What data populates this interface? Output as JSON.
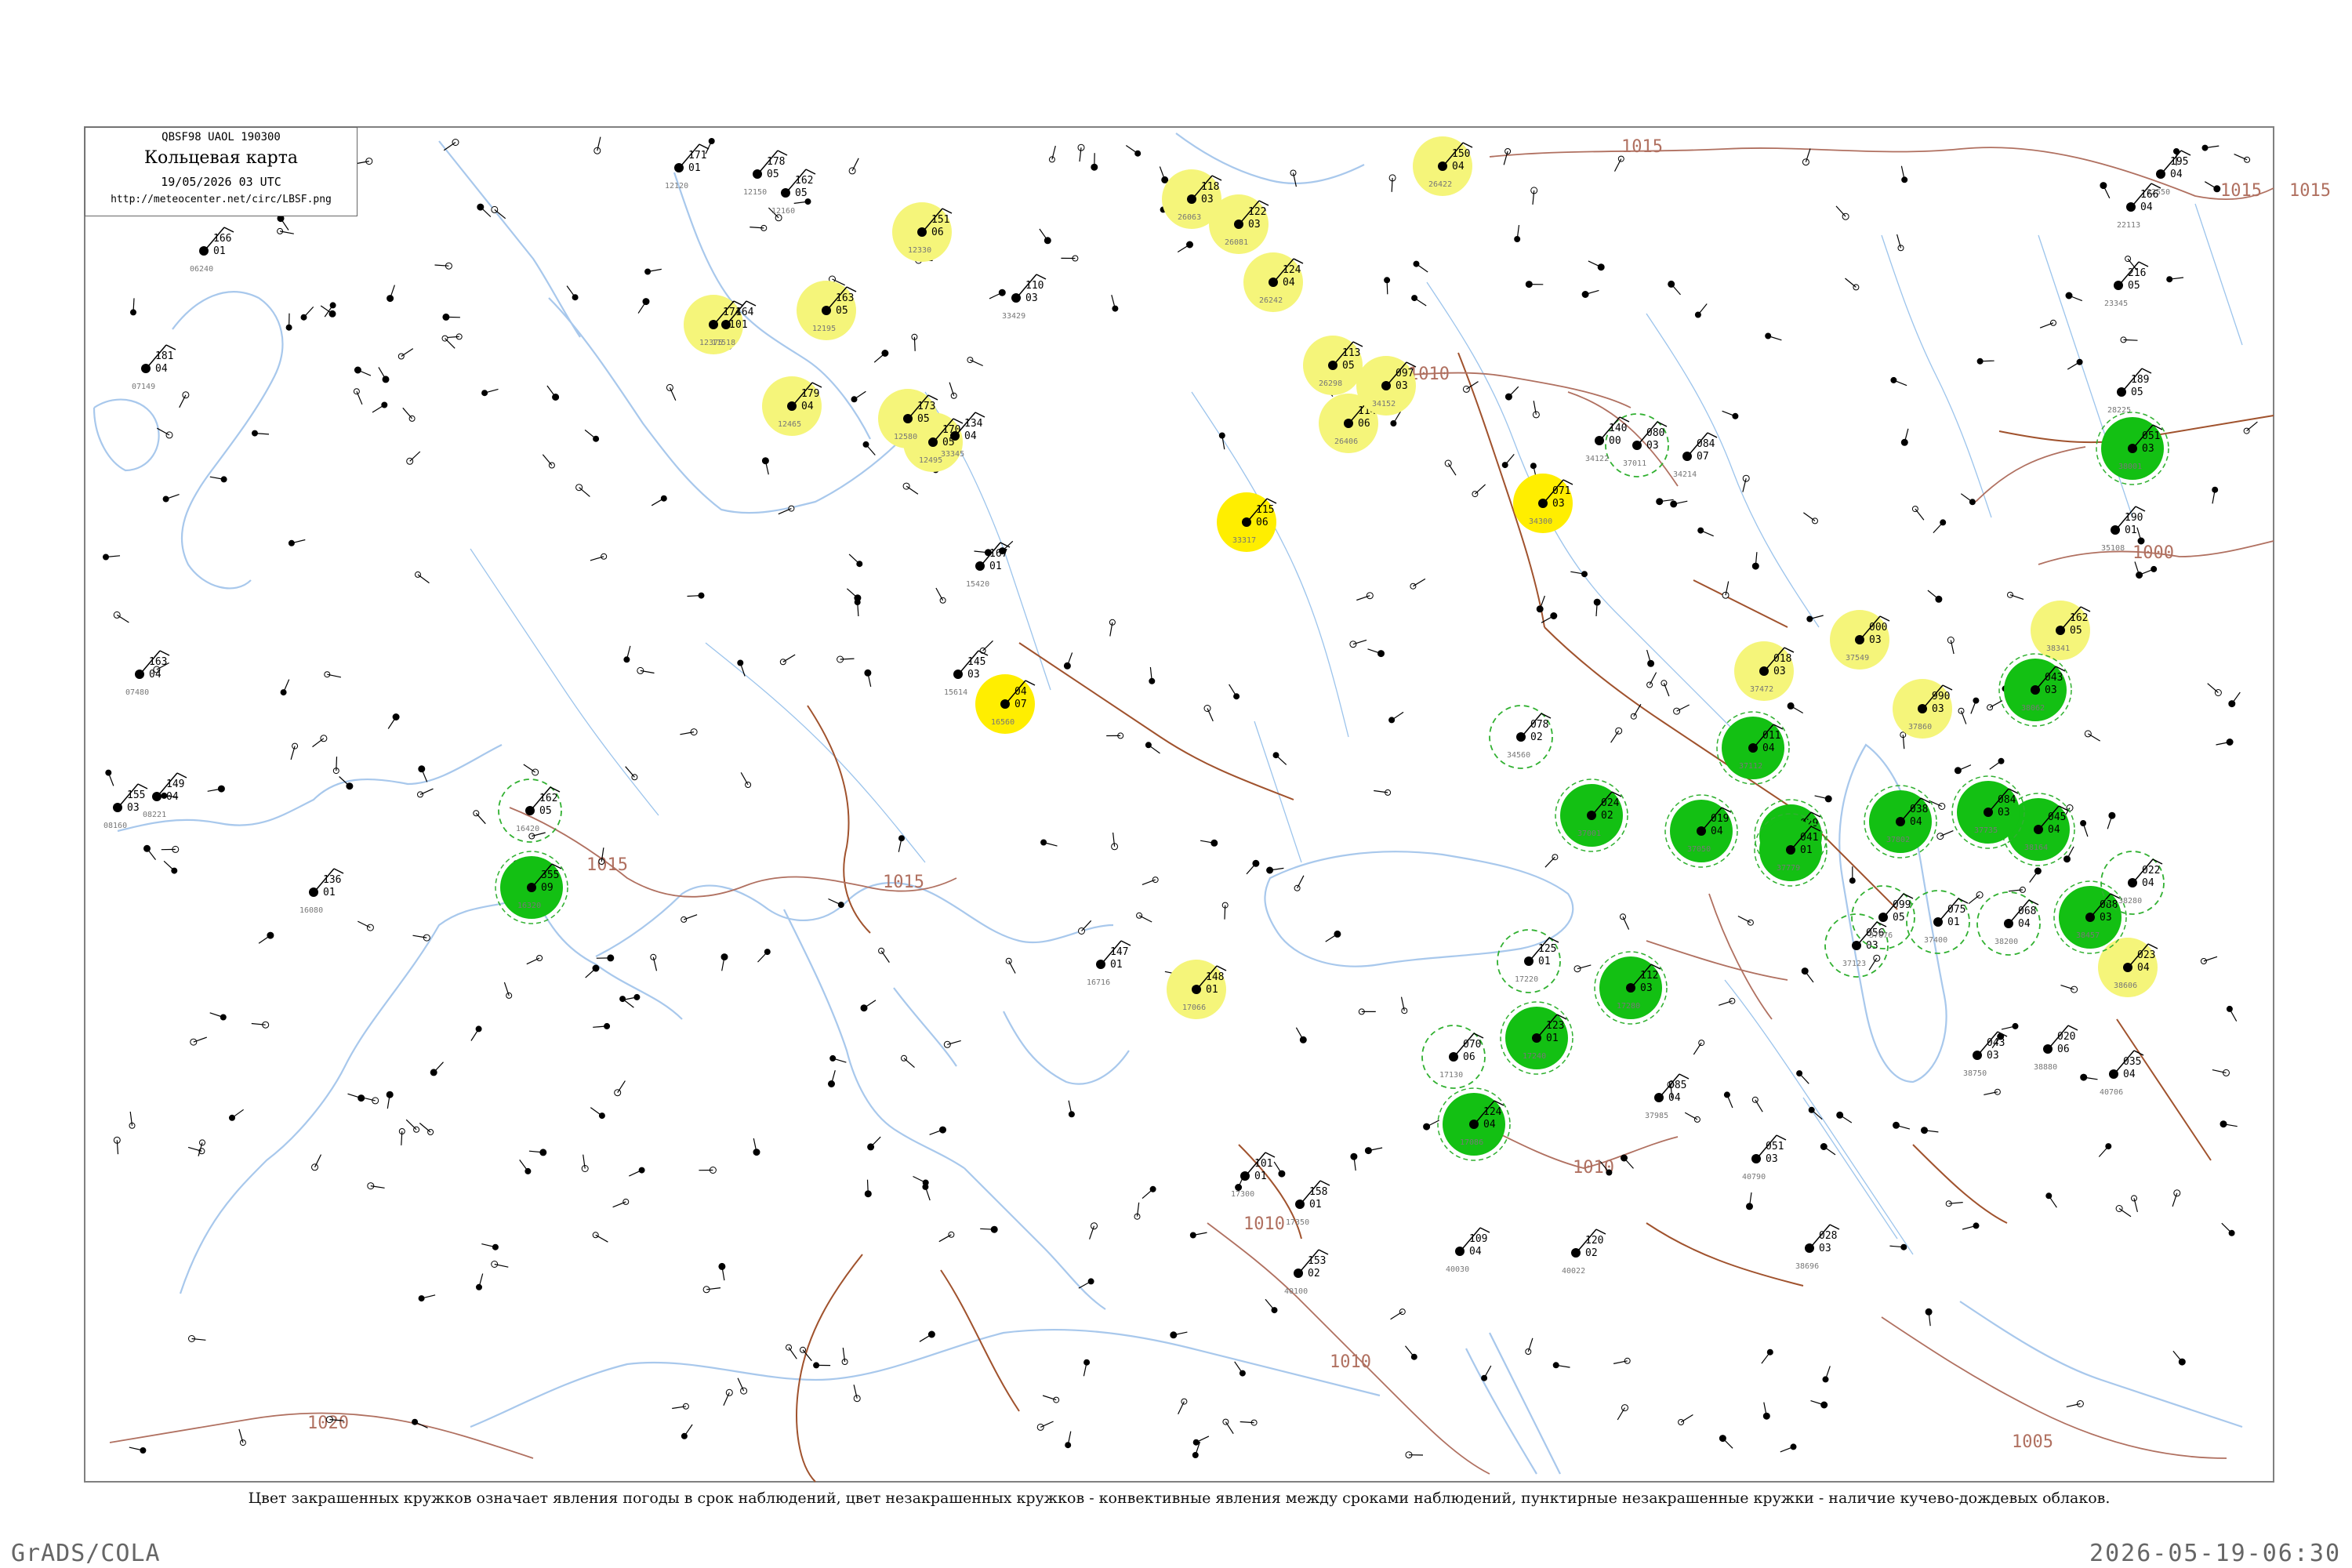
{
  "map": {
    "header": {
      "code_line": "QBSF98  UAOL  190300",
      "title": "Кольцевая карта",
      "datetime": "19/05/2026 03 UTC",
      "url": "http://meteocenter.net/circ/LBSF.png"
    },
    "note": "Цвет закрашенных кружков означает явления погоды в срок наблюдений, цвет незакрашенных кружков - конвективные явления между сроками наблюдений, пунктирные незакрашенные кружки - наличие кучево-дождевых облаков.",
    "footer": {
      "software": "GrADS/COLA",
      "timestamp": "2026-05-19-06:30"
    },
    "colors": {
      "frame": "#808080",
      "coast": "#a8c8ec",
      "river": "#9cc4ec",
      "border": "#a0522d",
      "isobar": "#b07060",
      "rain_fill": "#13c013",
      "drizzle_fill": "#f5f57a",
      "drizzle_strong": "#ffee00",
      "cb_ring": "#30b030"
    },
    "isobar_labels": [
      {
        "text": "1015"
      },
      {
        "text": "1015"
      },
      {
        "text": "1015"
      },
      {
        "text": "1015"
      },
      {
        "text": "1010"
      },
      {
        "text": "1010"
      },
      {
        "text": "1010"
      },
      {
        "text": "1010"
      },
      {
        "text": "1000"
      },
      {
        "text": "1020"
      },
      {
        "text": "1005"
      },
      {
        "text": "1015"
      }
    ],
    "stations": [
      {
        "p": "171",
        "t": "01",
        "idx": "12120",
        "w": "none"
      },
      {
        "p": "178",
        "t": "05",
        "idx": "12150",
        "w": "none"
      },
      {
        "p": "162",
        "t": "05",
        "idx": "12160",
        "w": "none"
      },
      {
        "p": "163",
        "t": "05",
        "idx": "12195",
        "w": "drizzle"
      },
      {
        "p": "174",
        "t": "01",
        "idx": "12375",
        "w": "drizzle"
      },
      {
        "p": "179",
        "t": "04",
        "idx": "12465",
        "w": "drizzle"
      },
      {
        "p": "170",
        "t": "05",
        "idx": "12495",
        "w": "drizzle"
      },
      {
        "p": "173",
        "t": "05",
        "idx": "12580",
        "w": "drizzle"
      },
      {
        "p": "151",
        "t": "06",
        "idx": "12330",
        "w": "drizzle"
      },
      {
        "p": "118",
        "t": "03",
        "idx": "26063",
        "w": "drizzle"
      },
      {
        "p": "122",
        "t": "03",
        "idx": "26081",
        "w": "drizzle"
      },
      {
        "p": "124",
        "t": "04",
        "idx": "26242",
        "w": "drizzle"
      },
      {
        "p": "113",
        "t": "05",
        "idx": "26298",
        "w": "drizzle"
      },
      {
        "p": "114",
        "t": "06",
        "idx": "26406",
        "w": "drizzle"
      },
      {
        "p": "150",
        "t": "04",
        "idx": "26422",
        "w": "drizzle"
      },
      {
        "p": "097",
        "t": "03",
        "idx": "34152",
        "w": "drizzle"
      },
      {
        "p": "071",
        "t": "03",
        "idx": "34300",
        "w": "drizzle_strong"
      },
      {
        "p": "115",
        "t": "06",
        "idx": "33317",
        "w": "drizzle_strong"
      },
      {
        "p": "04",
        "t": "07",
        "idx": "16560",
        "w": "drizzle_strong"
      },
      {
        "p": "148",
        "t": "01",
        "idx": "17066",
        "w": "drizzle"
      },
      {
        "p": "018",
        "t": "03",
        "idx": "37472",
        "w": "drizzle"
      },
      {
        "p": "000",
        "t": "03",
        "idx": "37549",
        "w": "drizzle"
      },
      {
        "p": "990",
        "t": "03",
        "idx": "37860",
        "w": "drizzle"
      },
      {
        "p": "162",
        "t": "05",
        "idx": "38341",
        "w": "drizzle"
      },
      {
        "p": "023",
        "t": "04",
        "idx": "38606",
        "w": "drizzle"
      },
      {
        "p": "355",
        "t": "09",
        "idx": "16320",
        "w": "rain"
      },
      {
        "p": "051",
        "t": "03",
        "idx": "38001",
        "w": "rain"
      },
      {
        "p": "024",
        "t": "02",
        "idx": "37001",
        "w": "rain"
      },
      {
        "p": "019",
        "t": "04",
        "idx": "37050",
        "w": "rain"
      },
      {
        "p": "011",
        "t": "04",
        "idx": "37112",
        "w": "rain"
      },
      {
        "p": "029",
        "t": "06",
        "idx": "37235",
        "w": "rain"
      },
      {
        "p": "043",
        "t": "03",
        "idx": "38062",
        "w": "rain"
      },
      {
        "p": "045",
        "t": "04",
        "idx": "38164",
        "w": "rain"
      },
      {
        "p": "041",
        "t": "01",
        "idx": "37779",
        "w": "rain"
      },
      {
        "p": "038",
        "t": "04",
        "idx": "37802",
        "w": "rain"
      },
      {
        "p": "123",
        "t": "01",
        "idx": "17240",
        "w": "rain"
      },
      {
        "p": "112",
        "t": "03",
        "idx": "17280",
        "w": "rain"
      },
      {
        "p": "124",
        "t": "04",
        "idx": "17086",
        "w": "rain"
      },
      {
        "p": "084",
        "t": "03",
        "idx": "37735",
        "w": "rain"
      },
      {
        "p": "088",
        "t": "03",
        "idx": "38457",
        "w": "rain"
      },
      {
        "p": "162",
        "t": "05",
        "idx": "16420",
        "w": "cb"
      },
      {
        "p": "078",
        "t": "02",
        "idx": "34560",
        "w": "cb"
      },
      {
        "p": "080",
        "t": "03",
        "idx": "37011",
        "w": "cb"
      },
      {
        "p": "056",
        "t": "03",
        "idx": "37123",
        "w": "cb"
      },
      {
        "p": "099",
        "t": "05",
        "idx": "37676",
        "w": "cb"
      },
      {
        "p": "125",
        "t": "01",
        "idx": "17220",
        "w": "cb"
      },
      {
        "p": "070",
        "t": "06",
        "idx": "17130",
        "w": "cb"
      },
      {
        "p": "068",
        "t": "04",
        "idx": "38200",
        "w": "cb"
      },
      {
        "p": "022",
        "t": "04",
        "idx": "38280",
        "w": "cb"
      },
      {
        "p": "075",
        "t": "01",
        "idx": "37400",
        "w": "cb"
      },
      {
        "p": "166",
        "t": "01",
        "idx": "06240",
        "w": "none"
      },
      {
        "p": "181",
        "t": "04",
        "idx": "07149",
        "w": "none"
      },
      {
        "p": "163",
        "t": "04",
        "idx": "07480",
        "w": "none"
      },
      {
        "p": "155",
        "t": "03",
        "idx": "08160",
        "w": "none"
      },
      {
        "p": "149",
        "t": "04",
        "idx": "08221",
        "w": "none"
      },
      {
        "p": "164",
        "t": "01",
        "idx": "11518",
        "w": "none"
      },
      {
        "p": "110",
        "t": "03",
        "idx": "33429",
        "w": "none"
      },
      {
        "p": "134",
        "t": "04",
        "idx": "33345",
        "w": "none"
      },
      {
        "p": "167",
        "t": "01",
        "idx": "15420",
        "w": "none"
      },
      {
        "p": "145",
        "t": "03",
        "idx": "15614",
        "w": "none"
      },
      {
        "p": "140",
        "t": "00",
        "idx": "34122",
        "w": "none"
      },
      {
        "p": "084",
        "t": "07",
        "idx": "34214",
        "w": "none"
      },
      {
        "p": "195",
        "t": "04",
        "idx": "22550",
        "w": "none"
      },
      {
        "p": "166",
        "t": "04",
        "idx": "22113",
        "w": "none"
      },
      {
        "p": "216",
        "t": "05",
        "idx": "23345",
        "w": "none"
      },
      {
        "p": "189",
        "t": "05",
        "idx": "28225",
        "w": "none"
      },
      {
        "p": "190",
        "t": "01",
        "idx": "35108",
        "w": "none"
      },
      {
        "p": "136",
        "t": "01",
        "idx": "16080",
        "w": "none"
      },
      {
        "p": "147",
        "t": "01",
        "idx": "16716",
        "w": "none"
      },
      {
        "p": "101",
        "t": "01",
        "idx": "17300",
        "w": "none"
      },
      {
        "p": "158",
        "t": "01",
        "idx": "17350",
        "w": "none"
      },
      {
        "p": "153",
        "t": "02",
        "idx": "40100",
        "w": "none"
      },
      {
        "p": "109",
        "t": "04",
        "idx": "40030",
        "w": "none"
      },
      {
        "p": "120",
        "t": "02",
        "idx": "40022",
        "w": "none"
      },
      {
        "p": "085",
        "t": "04",
        "idx": "37985",
        "w": "none"
      },
      {
        "p": "043",
        "t": "03",
        "idx": "38750",
        "w": "none"
      },
      {
        "p": "020",
        "t": "06",
        "idx": "38880",
        "w": "none"
      },
      {
        "p": "035",
        "t": "04",
        "idx": "40706",
        "w": "none"
      },
      {
        "p": "051",
        "t": "03",
        "idx": "40790",
        "w": "none"
      },
      {
        "p": "028",
        "t": "03",
        "idx": "38696",
        "w": "none"
      }
    ]
  }
}
